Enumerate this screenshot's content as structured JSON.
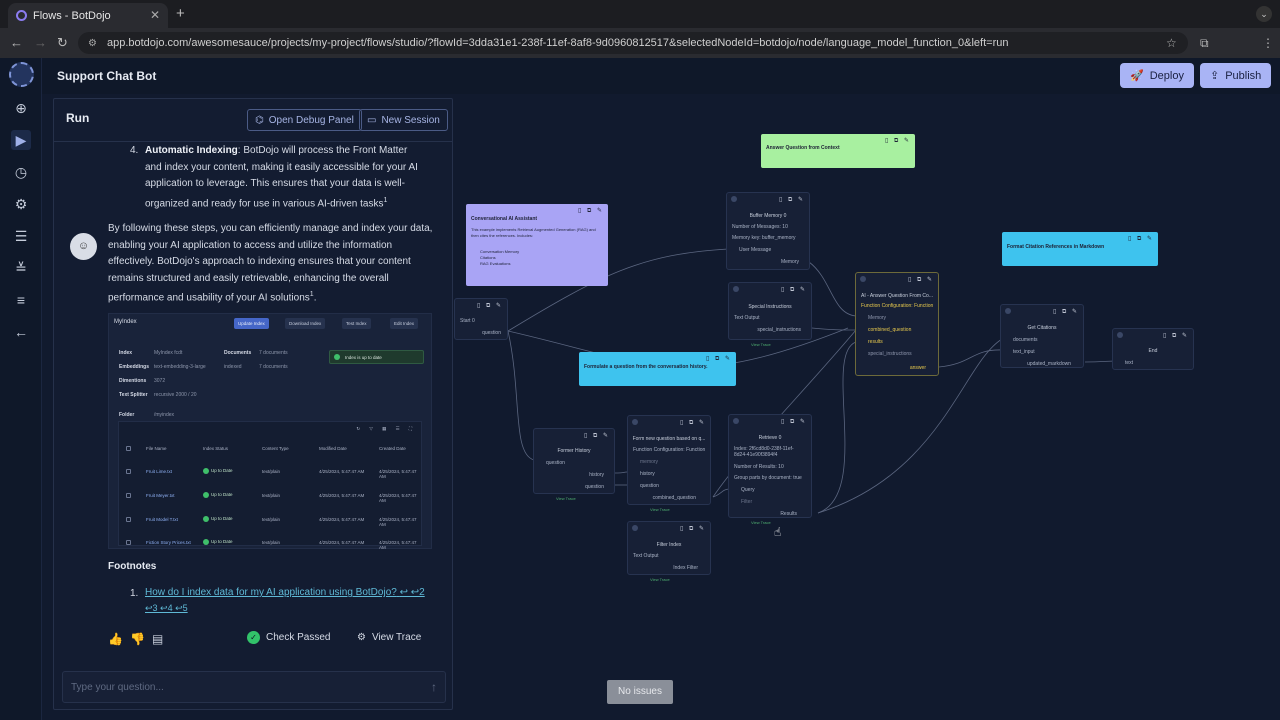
{
  "browser": {
    "tab_title": "Flows - BotDojo",
    "new_tab": "+",
    "url": "app.botdojo.com/awesomesauce/projects/my-project/flows/studio/?flowId=3dda31e1-238f-11ef-8af8-9d0960812517&selectedNodeId=botdojo/node/language_model_function_0&left=run"
  },
  "app": {
    "title": "Support Chat Bot",
    "deploy_label": "Deploy",
    "publish_label": "Publish"
  },
  "run_panel": {
    "title": "Run",
    "debug_label": "Open Debug Panel",
    "session_label": "New Session",
    "step4_num": "4.",
    "step4_bold": "Automatic Indexing",
    "step4_text": ": BotDojo will process the Front Matter and index your content, making it easily accessible for your AI application to leverage. This ensures that your data is well-organized and ready for use in various AI-driven tasks",
    "step4_sup": "1",
    "para": "By following these steps, you can efficiently manage and index your data, enabling your AI application to access and utilize the information effectively. BotDojo's approach to indexing ensures that your content remains structured and easily retrievable, enhancing the overall performance and usability of your AI solutions",
    "para_sup": "1",
    "period": ".",
    "footnotes_title": "Footnotes",
    "footnote_num": "1.",
    "footnote_link": "How do I index data for my AI application using BotDojo?",
    "footnote_backrefs": "↩ ↩2",
    "footnote_backrefs2": "↩3 ↩4 ↩5",
    "check_label": "Check Passed",
    "trace_label": "View Trace",
    "input_placeholder": "Type your question..."
  },
  "embed": {
    "title": "MyIndex",
    "buttons": [
      "Update Index",
      "Download Index",
      "Test Index",
      "Edit Index"
    ],
    "fields": [
      {
        "key": "Index",
        "value": "MyIndex   fcdt"
      },
      {
        "key": "Embeddings",
        "value": "text-embedding-3-large"
      },
      {
        "key": "Dimentions",
        "value": "3072"
      },
      {
        "key": "Text Splitter",
        "value": "recursive 2000 / 20"
      },
      {
        "key": "Folder",
        "value": "/myindex"
      }
    ],
    "documents_key": "Documents",
    "documents_value": "7 documents",
    "indexed_value": "indexed",
    "indexed_docs": "7 documents",
    "status": "Index is up to date",
    "headers": [
      "File Name",
      "Index Status",
      "Content Type",
      "Modified Date",
      "Created Date"
    ],
    "rows": [
      [
        "Fruit Lime.txt",
        "Up to Date",
        "text/plain",
        "4/25/2024, 5:47:47 AM",
        "4/25/2024, 5:47:47 AM"
      ],
      [
        "Fruit Meyer.txt",
        "Up to Date",
        "text/plain",
        "4/25/2024, 5:47:47 AM",
        "4/25/2024, 5:47:47 AM"
      ],
      [
        "Fruit Model T.txt",
        "Up to Date",
        "text/plain",
        "4/25/2024, 5:47:47 AM",
        "4/25/2024, 5:47:47 AM"
      ],
      [
        "Fiction Story Prices.txt",
        "Up to Date",
        "text/plain",
        "4/25/2024, 5:47:47 AM",
        "4/25/2024, 5:47:47 AM"
      ]
    ]
  },
  "canvas": {
    "notes": {
      "answer": "Answer Question from Context",
      "assistant": "Conversational AI Assistant",
      "assistant_body": "This example implements Retrieval Augmented Generation (RAG) and then cites the references. Includes:",
      "assistant_items": [
        "Conversation Memory",
        "Citations",
        "RAG Evaluations"
      ],
      "citation": "Format Citation References in Markdown",
      "formulate": "Formulate a question from the conversation history."
    },
    "nodes": {
      "start": {
        "title": "Start 0",
        "port": "question"
      },
      "buffer": {
        "title": "Buffer Memory 0",
        "l1": "Number of Messages: 10",
        "l2": "Memory key: buffer_memory",
        "in": "User Message",
        "out": "Memory"
      },
      "special": {
        "title": "Special Instructions",
        "l1": "Text Output",
        "out": "special_instructions",
        "trace": "View Trace"
      },
      "ai": {
        "title": "AI - Answer Question From Co...",
        "l1": "Function Configuration: Function",
        "p1": "Memory",
        "p2": "combined_question",
        "p3": "results",
        "p4": "special_instructions",
        "out": "answer"
      },
      "citations": {
        "title": "Get Citations",
        "p1": "documents",
        "p2": "text_input",
        "out": "updated_markdown"
      },
      "end": {
        "title": "End",
        "p1": "text"
      },
      "former": {
        "title": "Former History",
        "p1": "question",
        "p2": "history",
        "p3": "question",
        "trace": "View Trace"
      },
      "formq": {
        "title": "Form new question based on q...",
        "l1": "Function Configuration: Function",
        "p1": "memory",
        "p2": "history",
        "p3": "question",
        "out": "combined_question",
        "trace": "View Trace"
      },
      "retrieve": {
        "title": "Retrieve 0",
        "l1": "Index: 2f6cd8d0-238f-11ef-8d24-41e90f3894f4",
        "l2": "Number of Results: 10",
        "l3": "Group parts by document: true",
        "p1": "Query",
        "p2": "Filter",
        "out": "Results",
        "trace": "View Trace"
      },
      "filter": {
        "title": "Filter Index",
        "l1": "Text Output",
        "out": "Index Filter",
        "trace": "View Trace"
      }
    },
    "no_issues": "No issues"
  },
  "icons": {
    "nav": [
      "plus-circle-icon",
      "play-icon",
      "history-icon",
      "gear-icon",
      "list-icon",
      "checklist-icon",
      "logs-icon",
      "arrow-left-icon"
    ]
  }
}
